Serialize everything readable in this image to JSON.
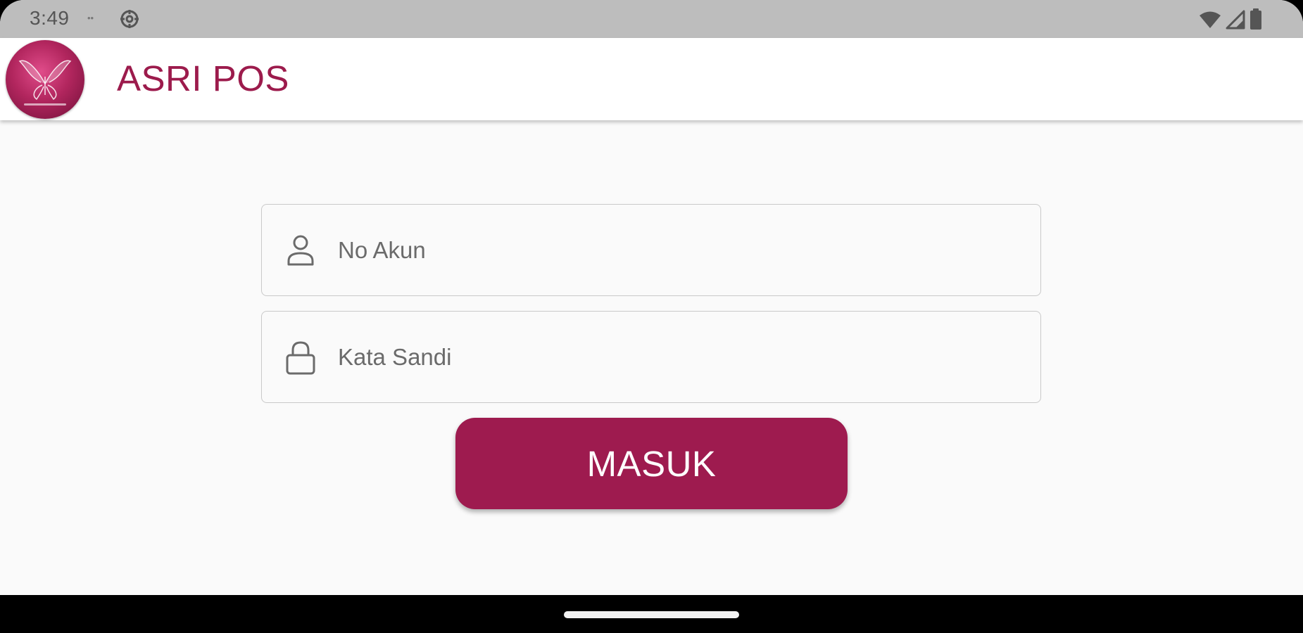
{
  "status_bar": {
    "time": "3:49",
    "icons": {
      "small_notification": "notification-dot-icon",
      "sync": "sync-settings-icon",
      "wifi": "wifi-icon",
      "signal": "cellular-signal-icon",
      "battery": "battery-icon"
    },
    "small_label": "••"
  },
  "app_bar": {
    "title": "ASRI POS",
    "logo": "butterfly-logo",
    "title_color": "#9c1b4c"
  },
  "login_form": {
    "account_field": {
      "placeholder": "No Akun",
      "value": "",
      "icon": "person-icon"
    },
    "password_field": {
      "placeholder": "Kata Sandi",
      "value": "",
      "icon": "lock-icon"
    },
    "submit_label": "MASUK",
    "button_color": "#9e1b4f"
  }
}
